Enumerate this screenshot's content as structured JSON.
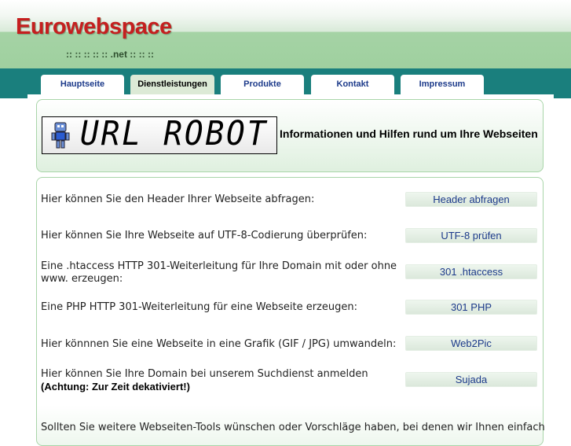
{
  "header": {
    "logo": "Eurowebspace",
    "subline": ":: :: :: :: :: .net :: :: ::"
  },
  "nav": {
    "tabs": [
      {
        "label": "Hauptseite"
      },
      {
        "label": "Dienstleistungen"
      },
      {
        "label": "Produkte"
      },
      {
        "label": "Kontakt"
      },
      {
        "label": "Impressum"
      }
    ]
  },
  "banner": {
    "title": "URL ROBOT",
    "tagline": "Informationen und Hilfen rund um Ihre Webseiten"
  },
  "services": [
    {
      "text": "Hier können Sie den Header Ihrer Webseite abfragen:",
      "button": "Header abfragen"
    },
    {
      "text": "Hier können Sie Ihre Webseite auf UTF-8-Codierung überprüfen:",
      "button": "UTF-8 prüfen"
    },
    {
      "text": "Eine .htaccess HTTP 301-Weiterleitung für Ihre Domain mit oder ohne www. erzeugen:",
      "button": "301 .htaccess"
    },
    {
      "text": "Eine PHP HTTP 301-Weiterleitung für eine Webseite erzeugen:",
      "button": "301 PHP"
    },
    {
      "text": "Hier könnnen Sie eine Webseite in eine Grafik (GIF / JPG) umwandeln:",
      "button": "Web2Pic"
    },
    {
      "text": "Hier können Sie Ihre Domain bei unserem Suchdienst anmelden",
      "note": "(Achtung: Zur Zeit dekativiert!)",
      "button": "Sujada"
    }
  ],
  "footer_text": "Sollten Sie weitere Webseiten-Tools wünschen oder Vorschläge haben, bei denen wir Ihnen einfach"
}
